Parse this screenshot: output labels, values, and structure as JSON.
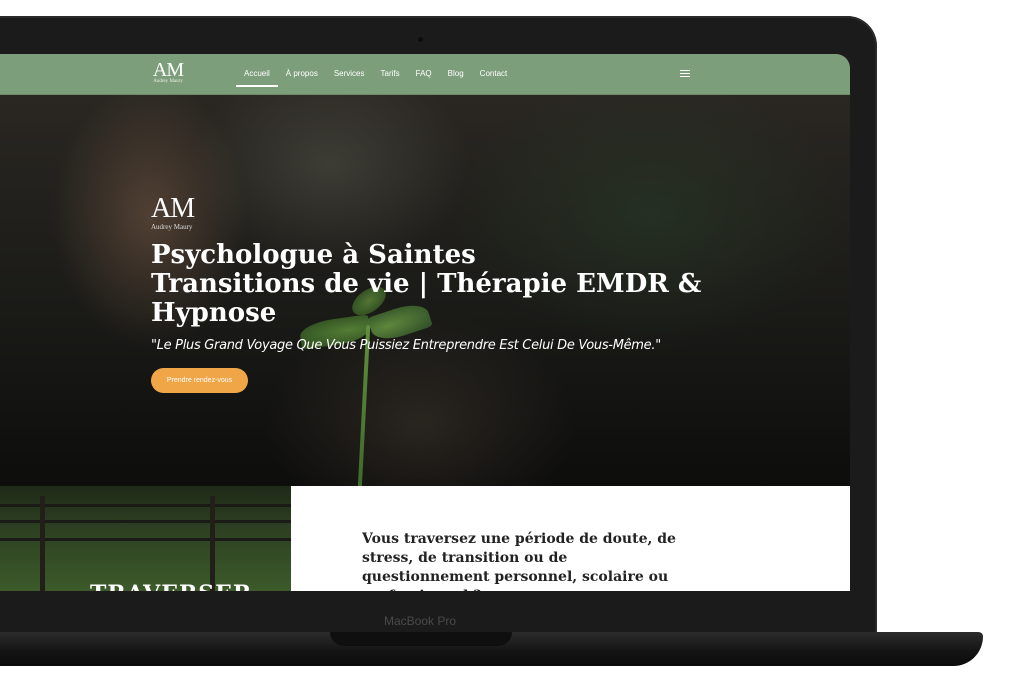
{
  "device": {
    "model_label": "MacBook Pro"
  },
  "site": {
    "logo_monogram": "AM",
    "logo_name": "Audrey Maury"
  },
  "nav": {
    "items": [
      {
        "label": "Accueil",
        "active": true
      },
      {
        "label": "À propos",
        "active": false
      },
      {
        "label": "Services",
        "active": false
      },
      {
        "label": "Tarifs",
        "active": false
      },
      {
        "label": "FAQ",
        "active": false
      },
      {
        "label": "Blog",
        "active": false
      },
      {
        "label": "Contact",
        "active": false
      }
    ],
    "menu_icon": "hamburger-icon"
  },
  "hero": {
    "title_line1": "Psychologue à Saintes",
    "title_line2": "Transitions de vie | Thérapie EMDR &",
    "title_line3": "Hypnose",
    "quote": "\"Le Plus Grand Voyage Que Vous Puissiez Entreprendre Est Celui De Vous-Même.\"",
    "cta_label": "Prendre rendez-vous"
  },
  "section": {
    "image_heading": "TRAVERSER",
    "question": "Vous traversez une période de doute, de stress, de transition ou de questionnement personnel, scolaire ou professionnel ?"
  },
  "colors": {
    "header_green": "#7d9e7b",
    "cta_orange": "#f0a647",
    "frame": "#1b1b1b"
  }
}
